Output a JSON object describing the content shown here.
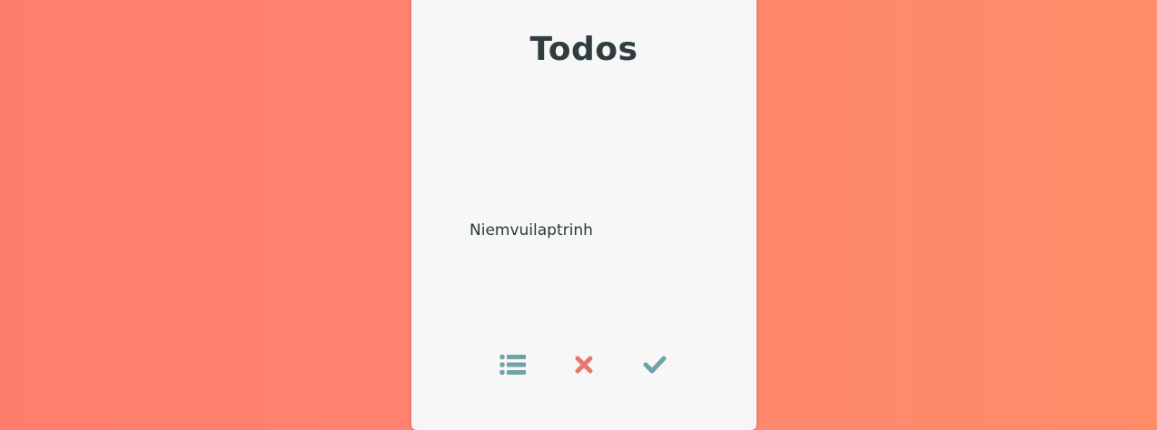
{
  "app": {
    "title": "Todos"
  },
  "todos": [
    {
      "text": "Niemvuilaptrinh"
    }
  ],
  "toolbar": {
    "buttons": [
      {
        "icon": "list-icon",
        "color": "#6fa3a5"
      },
      {
        "icon": "close-icon",
        "color": "#e8786a"
      },
      {
        "icon": "check-icon",
        "color": "#6fa3a5"
      }
    ]
  },
  "colors": {
    "background": "#ff8470",
    "card": "#f7f7f7",
    "title": "#2f3d3f",
    "accent_teal": "#6fa3a5",
    "accent_red": "#e8786a"
  }
}
